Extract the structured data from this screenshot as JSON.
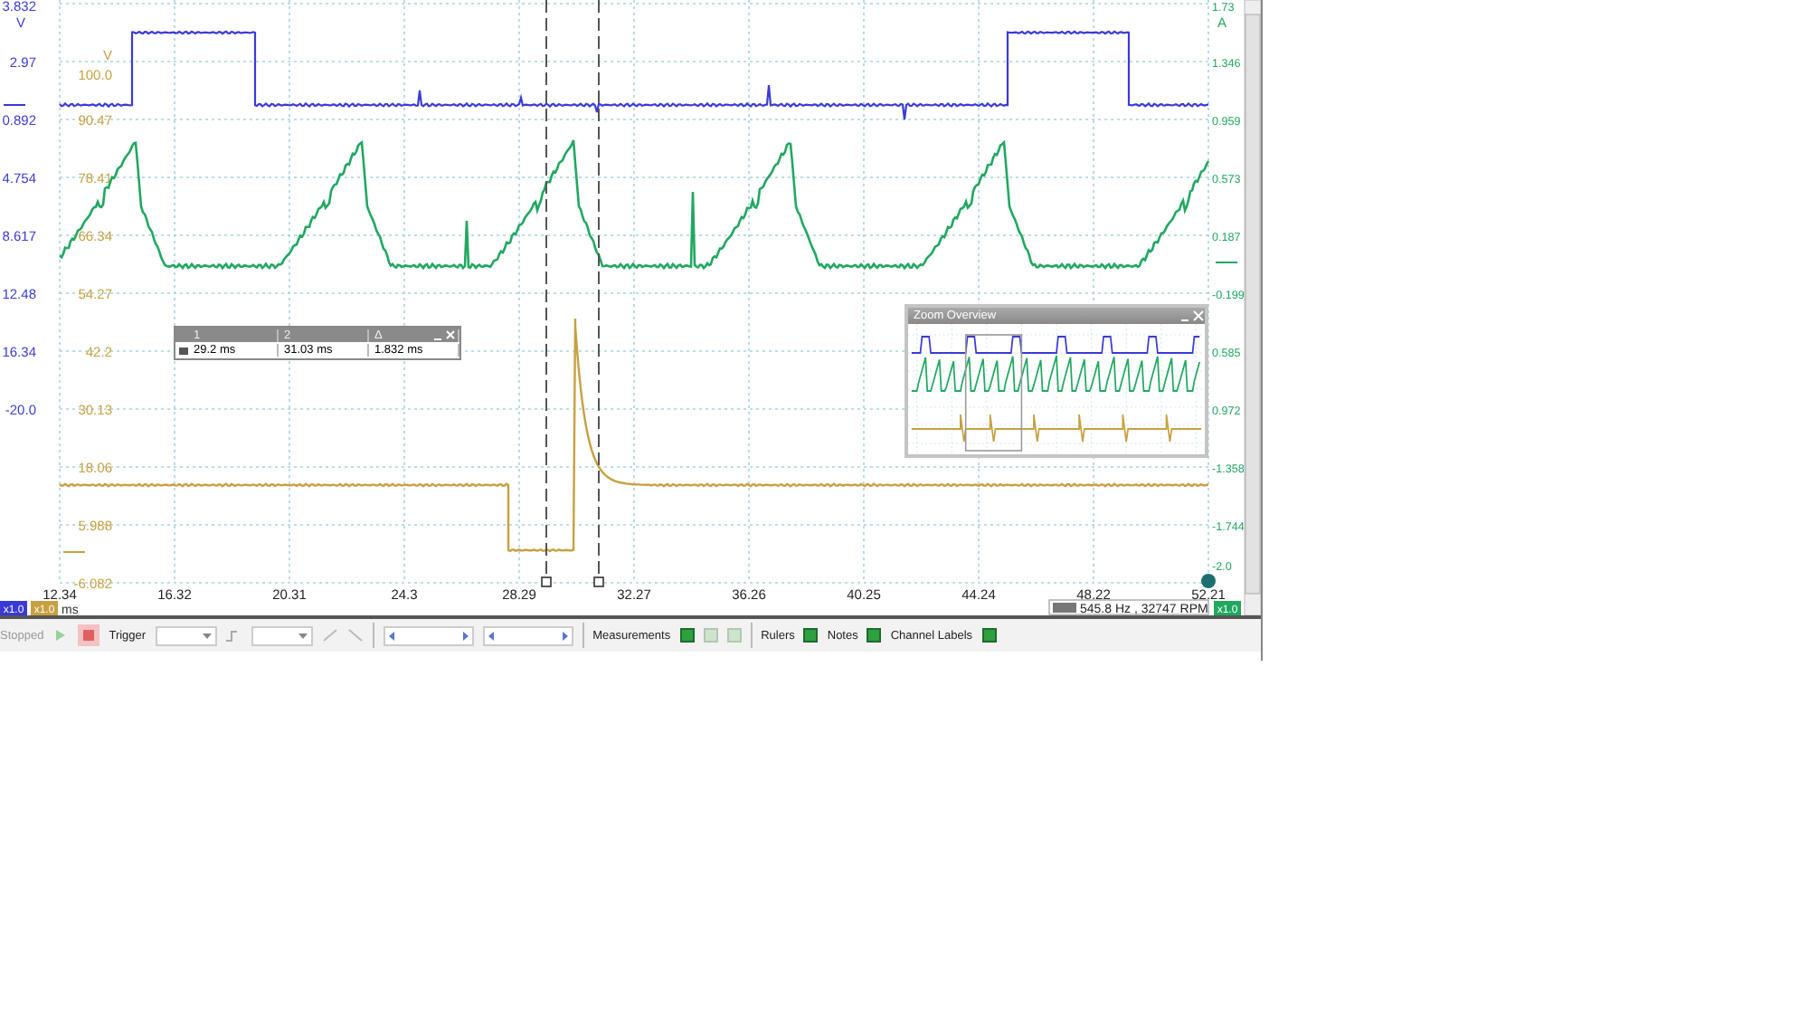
{
  "axes": [
    {
      "color": "#3a3ad8",
      "unit": "V",
      "scale": "x1.0",
      "ticks": [
        "3.832",
        "2.97",
        "0.892",
        "4.754",
        "8.617",
        "12.48",
        "16.34",
        "-20.0"
      ]
    },
    {
      "color": "#c8a040",
      "unit": "V",
      "scale": "x1.0",
      "ticks": [
        "100.0",
        "90.47",
        "78.41",
        "66.34",
        "54.27",
        "42.2",
        "30.13",
        "18.06",
        "5.988",
        "-6.082"
      ]
    },
    {
      "color": "#20a860",
      "unit": "A",
      "scale": "x1.0",
      "ticks": [
        "1.73",
        "1.346",
        "0.959",
        "0.573",
        "0.187",
        "-0.199",
        "0.585",
        "0.972",
        "-1.358",
        "-1.744",
        "-2.0"
      ]
    }
  ],
  "x_axis": {
    "unit": "ms",
    "ticks": [
      "12.34",
      "16.32",
      "20.31",
      "24.3",
      "28.29",
      "32.27",
      "36.26",
      "40.25",
      "44.24",
      "48.22",
      "52.21"
    ]
  },
  "rulers_table": {
    "headers": [
      "1",
      "2",
      "Δ"
    ],
    "values": [
      "29.2 ms",
      "31.03 ms",
      "1.832 ms"
    ]
  },
  "zoom_overview": {
    "title": "Zoom Overview"
  },
  "status_readout": "545.8 Hz , 32747 RPM",
  "toolbar": {
    "status": "Stopped",
    "trigger": "Trigger",
    "measurements": "Measurements",
    "rulers": "Rulers",
    "notes": "Notes",
    "channel_labels": "Channel Labels"
  }
}
